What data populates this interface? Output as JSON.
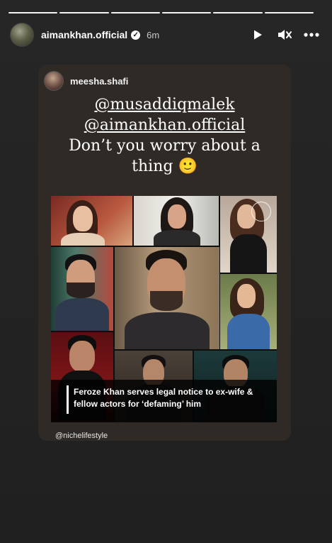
{
  "story": {
    "progress_segments": 6,
    "username": "aimankhan.official",
    "verified": true,
    "time_ago": "6m"
  },
  "controls": {
    "play": "play-icon",
    "mute": "muted-speaker-icon",
    "more": "more-horizontal-icon"
  },
  "shared_post": {
    "username": "meesha.shafi",
    "caption_mention_1": "@musaddiqmalek",
    "caption_mention_2": "@aimankhan.official",
    "caption_line_1": "Don’t you worry about a",
    "caption_line_2": "thing 🙂",
    "headline": "Feroze Khan serves legal notice to ex-wife & fellow actors for ‘defaming’ him",
    "handle": "@nichelifestyle"
  },
  "colors": {
    "background": "#1b1b1b",
    "card": "#2f2a26",
    "text": "#ffffff"
  }
}
